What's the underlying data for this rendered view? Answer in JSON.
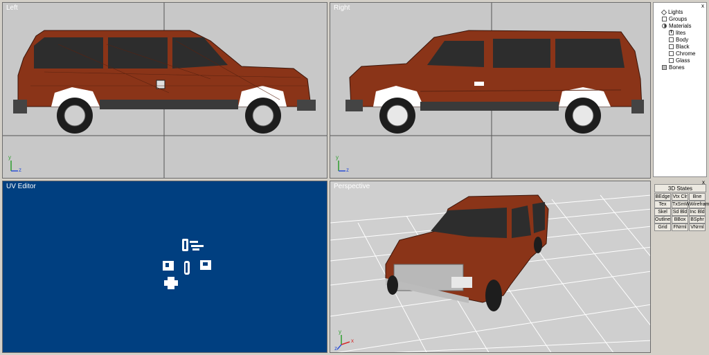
{
  "viewports": {
    "left": {
      "title": "Left"
    },
    "right": {
      "title": "Right"
    },
    "uv": {
      "title": "UV Editor"
    },
    "perspective": {
      "title": "Perspective"
    }
  },
  "scene_tree": {
    "close": "x",
    "items": [
      {
        "label": "Lights",
        "icon": "light-icon",
        "level": 1
      },
      {
        "label": "Groups",
        "icon": "groups-icon",
        "level": 1
      },
      {
        "label": "Materials",
        "icon": "materials-icon",
        "level": 1
      },
      {
        "label": "lites",
        "icon": "texture-icon",
        "level": 2
      },
      {
        "label": "Body",
        "icon": "material-icon",
        "level": 2
      },
      {
        "label": "Black",
        "icon": "material-icon",
        "level": 2
      },
      {
        "label": "Chrome",
        "icon": "material-icon",
        "level": 2
      },
      {
        "label": "Glass",
        "icon": "material-icon",
        "level": 2
      },
      {
        "label": "Bones",
        "icon": "bones-icon",
        "level": 1
      }
    ]
  },
  "states_panel": {
    "close": "x",
    "title": "3D States",
    "buttons": [
      [
        "BEdge",
        "Vtx Clr",
        "Bne Clr"
      ],
      [
        "Tex Srn",
        "TxSmWr",
        "Wireframe"
      ],
      [
        "Skel",
        "Sd Bld",
        "Inc Bld"
      ],
      [
        "Outline",
        "BBox",
        "BSphr"
      ],
      [
        "Grid",
        "FNrml",
        "VNrml"
      ]
    ]
  },
  "axes": {
    "y": "y",
    "z": "z",
    "x": "x"
  },
  "colors": {
    "body": "#8a3418",
    "uv_background": "#003f80",
    "viewport_grey": "#c8c8c8"
  }
}
